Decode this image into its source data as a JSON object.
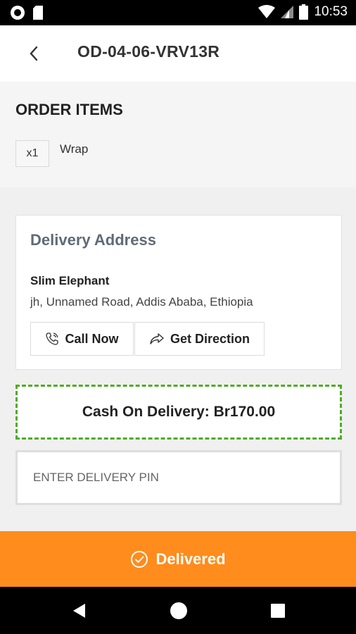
{
  "status_bar": {
    "time": "10:53"
  },
  "header": {
    "title": "OD-04-06-VRV13R"
  },
  "order_items": {
    "title": "ORDER ITEMS",
    "items": [
      {
        "qty": "x1",
        "name": "Wrap"
      }
    ]
  },
  "delivery_address": {
    "title": "Delivery Address",
    "name": "Slim Elephant",
    "address": "jh, Unnamed Road, Addis Ababa, Ethiopia",
    "call_label": "Call Now",
    "direction_label": "Get Direction"
  },
  "payment": {
    "label": "Cash On Delivery: Br170.00"
  },
  "pin": {
    "placeholder": "ENTER DELIVERY PIN",
    "value": ""
  },
  "action": {
    "label": "Delivered"
  },
  "colors": {
    "accent": "#ff8c1c",
    "dashed_border": "#4caf1e",
    "card_title": "#5f6b76"
  }
}
